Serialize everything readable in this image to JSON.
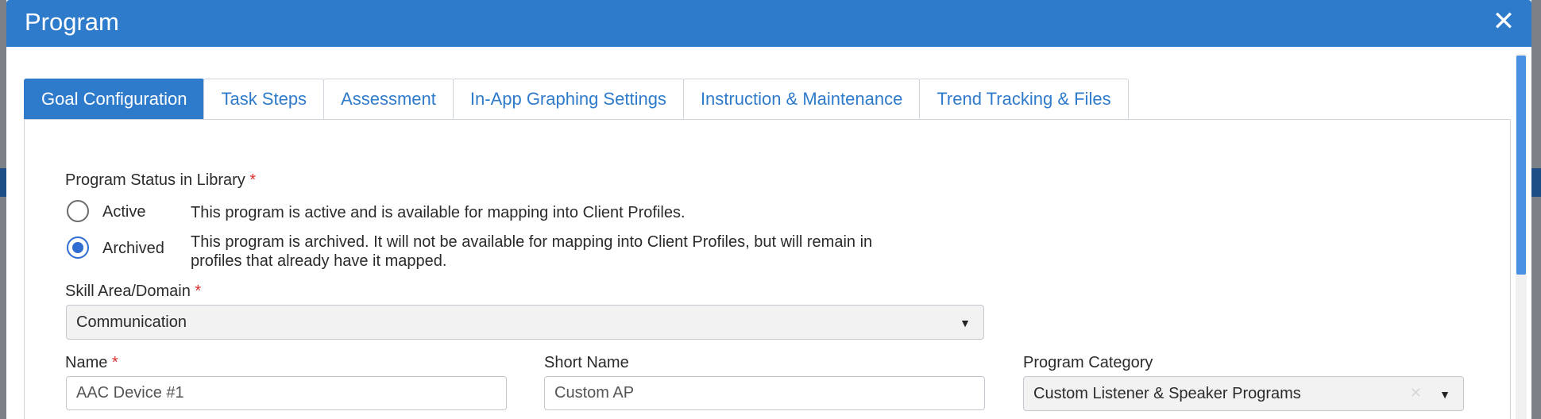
{
  "modal": {
    "title": "Program"
  },
  "tabs": [
    {
      "label": "Goal Configuration",
      "active": true
    },
    {
      "label": "Task Steps",
      "active": false
    },
    {
      "label": "Assessment",
      "active": false
    },
    {
      "label": "In-App Graphing Settings",
      "active": false
    },
    {
      "label": "Instruction & Maintenance",
      "active": false
    },
    {
      "label": "Trend Tracking & Files",
      "active": false
    }
  ],
  "status": {
    "label": "Program Status in Library",
    "required_mark": "*",
    "options": [
      {
        "label": "Active",
        "checked": false,
        "description": "This program is active and is available for mapping into Client Profiles."
      },
      {
        "label": "Archived",
        "checked": true,
        "description_line1": "This program is archived. It will not be available for mapping into Client Profiles, but will remain in",
        "description_line2": "profiles that already have it mapped."
      }
    ]
  },
  "skill_area": {
    "label": "Skill Area/Domain",
    "required_mark": "*",
    "value": "Communication"
  },
  "name": {
    "label": "Name",
    "required_mark": "*",
    "value": "AAC Device #1"
  },
  "short_name": {
    "label": "Short Name",
    "value": "Custom AP"
  },
  "program_category": {
    "label": "Program Category",
    "value": "Custom Listener & Speaker Programs"
  },
  "icons": {
    "close": "close-icon",
    "dropdown": "chevron-down-icon",
    "clear": "clear-icon"
  },
  "colors": {
    "header": "#2f7bcb",
    "required": "#d9302c",
    "radio_checked": "#2f6dd1"
  }
}
